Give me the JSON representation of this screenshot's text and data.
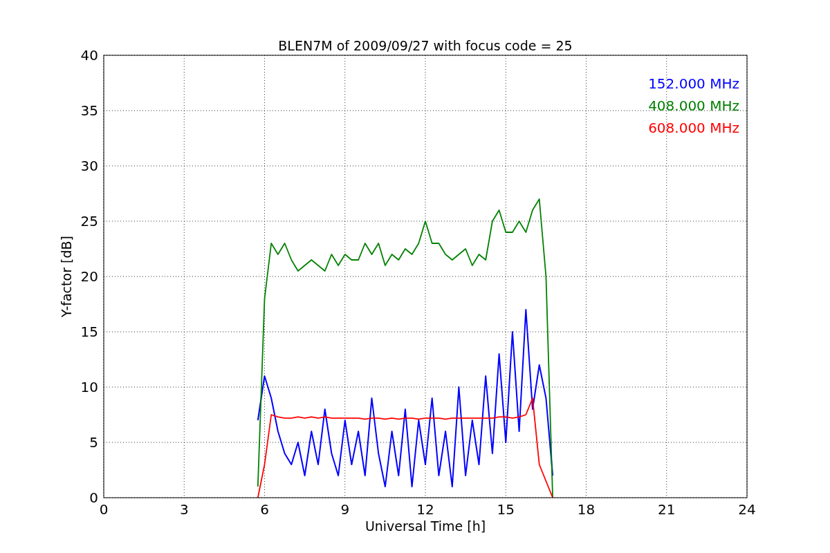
{
  "figure": {
    "chart_data": {
      "type": "line",
      "title": "BLEN7M of 2009/09/27 with focus code = 25",
      "xlabel": "Universal Time [h]",
      "ylabel": "Y-factor [dB]",
      "x": [
        5.75,
        6,
        6.25,
        6.5,
        6.75,
        7,
        7.25,
        7.5,
        7.75,
        8,
        8.25,
        8.5,
        8.75,
        9,
        9.25,
        9.5,
        9.75,
        10,
        10.25,
        10.5,
        10.75,
        11,
        11.25,
        11.5,
        11.75,
        12,
        12.25,
        12.5,
        12.75,
        13,
        13.25,
        13.5,
        13.75,
        14,
        14.25,
        14.5,
        14.75,
        15,
        15.25,
        15.5,
        15.75,
        16,
        16.25,
        16.5,
        16.75
      ],
      "series": [
        {
          "name": "152.000 MHz",
          "color": "#0000ff",
          "values": [
            7,
            11,
            9,
            6,
            4,
            3,
            5,
            2,
            6,
            3,
            8,
            4,
            2,
            7,
            3,
            6,
            2,
            9,
            4,
            1,
            6,
            2,
            8,
            1,
            7,
            3,
            9,
            2,
            6,
            1,
            10,
            2,
            7,
            3,
            11,
            4,
            13,
            5,
            15,
            6,
            17,
            8,
            12,
            9,
            2
          ]
        },
        {
          "name": "408.000 MHz",
          "color": "#008000",
          "values": [
            1,
            18,
            23,
            22,
            23,
            21.5,
            20.5,
            21,
            21.5,
            21,
            20.5,
            22,
            21,
            22,
            21.5,
            21.5,
            23,
            22,
            23,
            21,
            22,
            21.5,
            22.5,
            22,
            23,
            25,
            23,
            23,
            22,
            21.5,
            22,
            22.5,
            21,
            22,
            21.5,
            25,
            26,
            24,
            24,
            25,
            24,
            26,
            27,
            20,
            0
          ]
        },
        {
          "name": "608.000 MHz",
          "color": "#ff0000",
          "values": [
            0,
            3,
            7.5,
            7.3,
            7.2,
            7.2,
            7.3,
            7.2,
            7.3,
            7.2,
            7.3,
            7.2,
            7.2,
            7.2,
            7.2,
            7.2,
            7.1,
            7.2,
            7.2,
            7.1,
            7.2,
            7.1,
            7.2,
            7.2,
            7.1,
            7.2,
            7.2,
            7.2,
            7.1,
            7.2,
            7.2,
            7.2,
            7.2,
            7.2,
            7.2,
            7.2,
            7.3,
            7.3,
            7.2,
            7.3,
            7.5,
            9,
            3,
            1.5,
            0
          ]
        }
      ],
      "grid": true,
      "xlim": [
        0,
        24
      ],
      "ylim": [
        0,
        40
      ],
      "xticks": [
        0,
        3,
        6,
        9,
        12,
        15,
        18,
        21,
        24
      ],
      "yticks": [
        0,
        5,
        10,
        15,
        20,
        25,
        30,
        35,
        40
      ]
    }
  }
}
